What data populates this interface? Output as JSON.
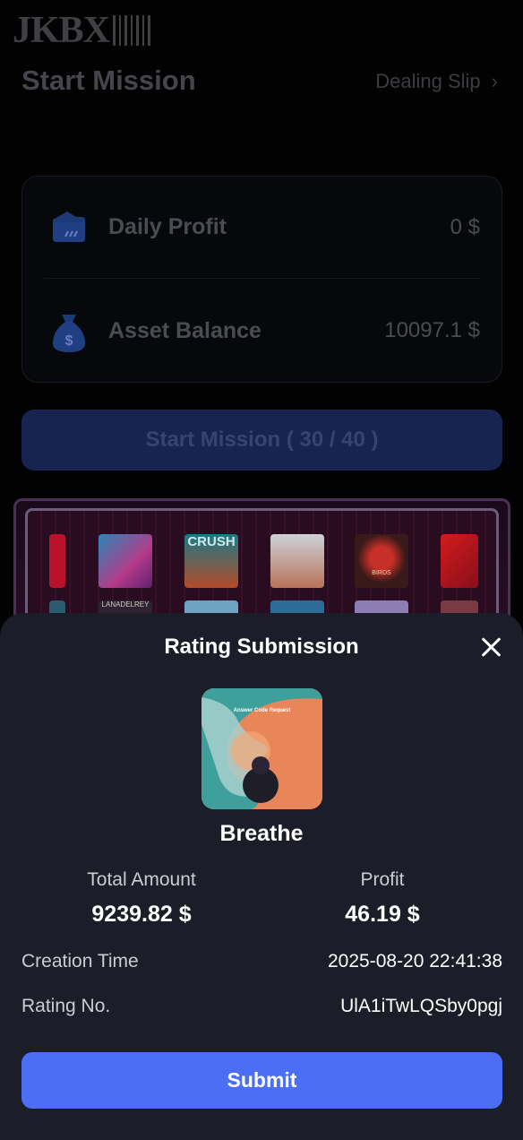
{
  "header": {
    "logo_text": "JKBX",
    "title": "Start Mission",
    "dealing_link": "Dealing Slip"
  },
  "stats": {
    "daily_profit_label": "Daily Profit",
    "daily_profit_value": "0 $",
    "asset_balance_label": "Asset Balance",
    "asset_balance_value": "10097.1 $"
  },
  "start_button": {
    "label": "Start Mission ( 30 / 40 )"
  },
  "gallery": {
    "covers": [
      "CRUSH",
      "BIRDS",
      "LANADELREY"
    ]
  },
  "modal": {
    "title": "Rating Submission",
    "artwork_text": "Answer Code Request",
    "song_title": "Breathe",
    "total_amount_label": "Total Amount",
    "total_amount_value": "9239.82 $",
    "profit_label": "Profit",
    "profit_value": "46.19 $",
    "creation_time_label": "Creation Time",
    "creation_time_value": "2025-08-20 22:41:38",
    "rating_no_label": "Rating No.",
    "rating_no_value": "UlA1iTwLQSby0pgj",
    "submit_label": "Submit"
  },
  "colors": {
    "submit": "#4b6ef5",
    "sheet_bg": "#1b1e28",
    "start_button_bg": "#172451"
  }
}
